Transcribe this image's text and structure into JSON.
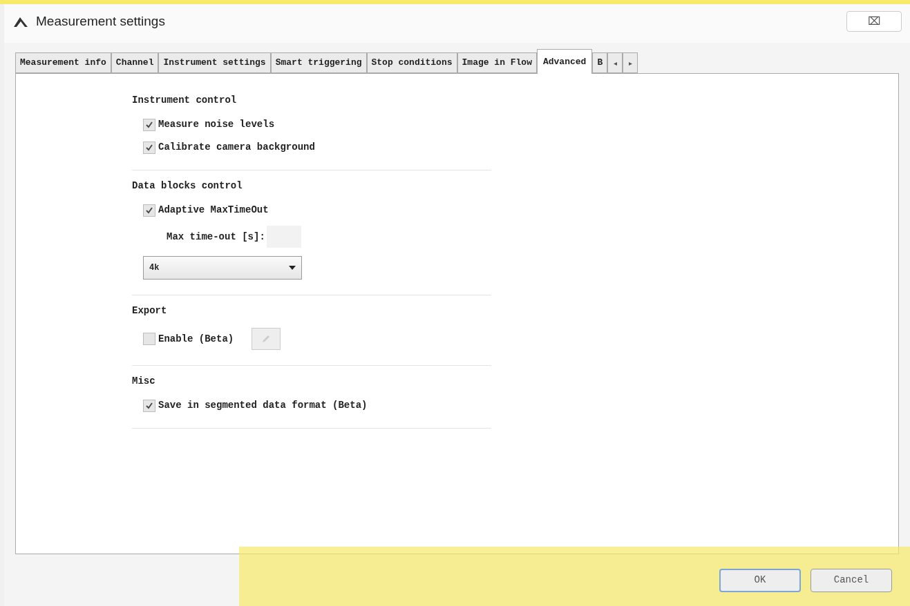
{
  "window": {
    "title": "Measurement settings",
    "close": "⌧"
  },
  "tabs": [
    {
      "label": "Measurement info",
      "selected": false
    },
    {
      "label": "Channel",
      "selected": false
    },
    {
      "label": "Instrument settings",
      "selected": false
    },
    {
      "label": "Smart triggering",
      "selected": false
    },
    {
      "label": "Stop conditions",
      "selected": false
    },
    {
      "label": "Image in Flow",
      "selected": false
    },
    {
      "label": "Advanced",
      "selected": true
    },
    {
      "label": "B",
      "selected": false
    }
  ],
  "tab_scroll": [
    "◂",
    "▸"
  ],
  "sections": [
    {
      "title": "Instrument control",
      "items": [
        {
          "kind": "checkbox",
          "label": "Measure noise levels",
          "checked": true
        },
        {
          "kind": "checkbox",
          "label": "Calibrate camera background",
          "checked": true
        }
      ]
    },
    {
      "title": "Data blocks control",
      "items": [
        {
          "kind": "checkbox",
          "label": "Adaptive MaxTimeOut",
          "checked": true
        },
        {
          "kind": "field",
          "label": "Max time-out [s]:"
        },
        {
          "kind": "dropdown",
          "value": "4k"
        }
      ]
    },
    {
      "title": "Export",
      "items": [
        {
          "kind": "checkbox",
          "label": "Enable (Beta)",
          "checked": false,
          "icon_button": true
        }
      ]
    },
    {
      "title": "Misc",
      "items": [
        {
          "kind": "checkbox",
          "label": "Save in segmented data format (Beta)",
          "checked": true
        }
      ]
    }
  ],
  "buttons": [
    {
      "label": "OK",
      "default": true
    },
    {
      "label": "Cancel",
      "default": false
    }
  ]
}
